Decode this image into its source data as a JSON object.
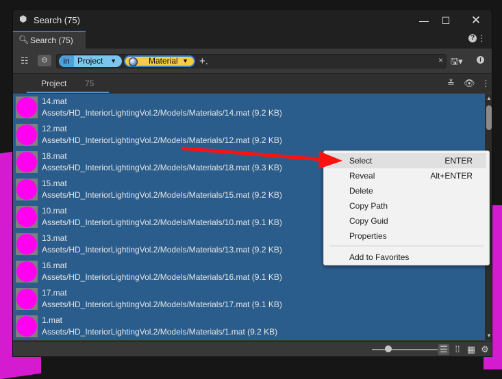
{
  "window": {
    "title": "Search (75)"
  },
  "tab": {
    "label": "Search (75)"
  },
  "search": {
    "chip_project_key": "in",
    "chip_project_value": "Project",
    "chip_material_value": "Material",
    "add_filter": "+.",
    "clear": "×"
  },
  "group": {
    "label": "Project",
    "count": "75"
  },
  "results": [
    {
      "name": "14.mat",
      "path": "Assets/HD_InteriorLightingVol.2/Models/Materials/14.mat (9.2 KB)"
    },
    {
      "name": "12.mat",
      "path": "Assets/HD_InteriorLightingVol.2/Models/Materials/12.mat (9.2 KB)"
    },
    {
      "name": "18.mat",
      "path": "Assets/HD_InteriorLightingVol.2/Models/Materials/18.mat (9.3 KB)"
    },
    {
      "name": "15.mat",
      "path": "Assets/HD_InteriorLightingVol.2/Models/Materials/15.mat (9.2 KB)"
    },
    {
      "name": "10.mat",
      "path": "Assets/HD_InteriorLightingVol.2/Models/Materials/10.mat (9.1 KB)"
    },
    {
      "name": "13.mat",
      "path": "Assets/HD_InteriorLightingVol.2/Models/Materials/13.mat (9.2 KB)"
    },
    {
      "name": "16.mat",
      "path": "Assets/HD_InteriorLightingVol.2/Models/Materials/16.mat (9.1 KB)"
    },
    {
      "name": "17.mat",
      "path": "Assets/HD_InteriorLightingVol.2/Models/Materials/17.mat (9.1 KB)"
    },
    {
      "name": "1.mat",
      "path": "Assets/HD_InteriorLightingVol.2/Models/Materials/1.mat (9.2 KB)"
    }
  ],
  "context_menu": {
    "items": [
      {
        "label": "Select",
        "shortcut": "ENTER"
      },
      {
        "label": "Reveal",
        "shortcut": "Alt+ENTER"
      },
      {
        "label": "Delete",
        "shortcut": ""
      },
      {
        "label": "Copy Path",
        "shortcut": ""
      },
      {
        "label": "Copy Guid",
        "shortcut": ""
      },
      {
        "label": "Properties",
        "shortcut": ""
      },
      {
        "label": "Add to Favorites",
        "shortcut": ""
      }
    ]
  },
  "colors": {
    "selection": "#2b5d8c",
    "material_preview": "#ff00f0",
    "chip_project": "#7bc6ef",
    "chip_material": "#f2cc45",
    "annotation_arrow": "#ff1111"
  },
  "icons": {
    "app": "unity-cube-icon",
    "tab": "search-icon",
    "save": "save-dropdown-icon",
    "info": "info-icon",
    "help": "help-icon",
    "view_list": "list-view-icon",
    "view_grid_small": "compact-grid-icon",
    "view_grid": "grid-view-icon",
    "settings": "gear-icon"
  }
}
